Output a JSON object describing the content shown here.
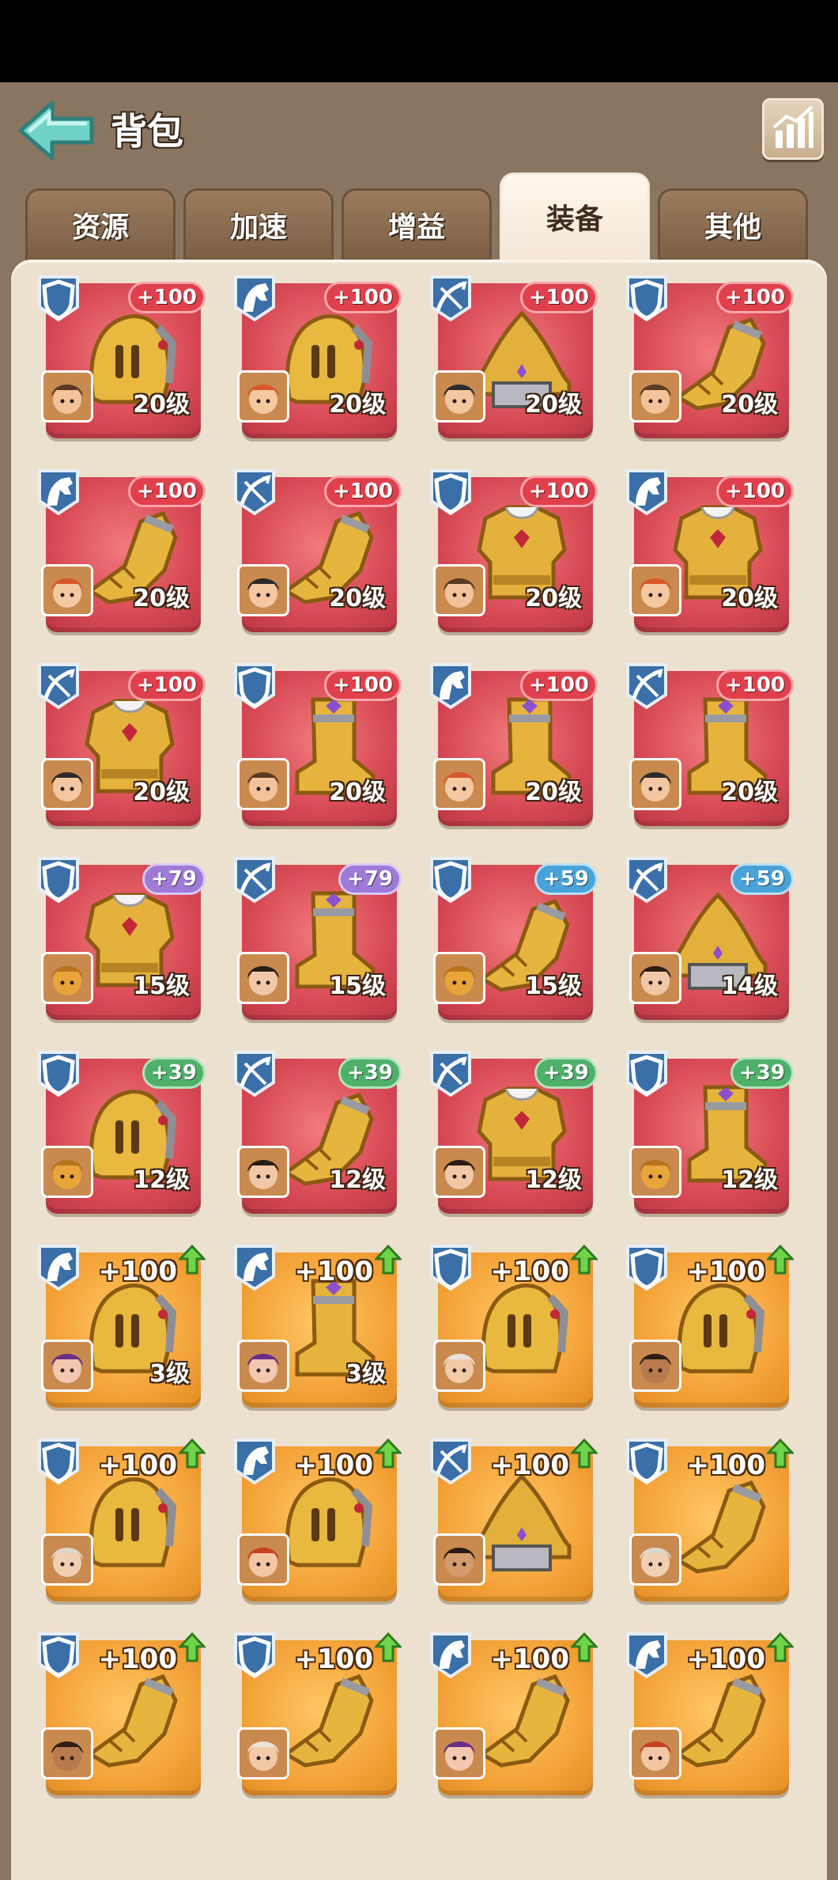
{
  "header": {
    "title": "背包"
  },
  "tabs": [
    {
      "label": "资源"
    },
    {
      "label": "加速"
    },
    {
      "label": "增益"
    },
    {
      "label": "装备",
      "active": true
    },
    {
      "label": "其他"
    }
  ],
  "colors": {
    "card_red": "#d84a55",
    "card_orange": "#f4a43a",
    "panel": "#ece1cf",
    "frame": "#8a7560"
  },
  "items": [
    {
      "bg": "red",
      "cls": "shield",
      "bonus": "+100",
      "bonus_style": "red",
      "level": "20级",
      "piece": "helmet",
      "hero": "hero-boy"
    },
    {
      "bg": "red",
      "cls": "horse",
      "bonus": "+100",
      "bonus_style": "red",
      "level": "20级",
      "piece": "helmet",
      "hero": "hero-redhair"
    },
    {
      "bg": "red",
      "cls": "bow",
      "bonus": "+100",
      "bonus_style": "red",
      "level": "20级",
      "piece": "hat",
      "hero": "hero-pirate"
    },
    {
      "bg": "red",
      "cls": "shield",
      "bonus": "+100",
      "bonus_style": "red",
      "level": "20级",
      "piece": "gauntlet",
      "hero": "hero-boy"
    },
    {
      "bg": "red",
      "cls": "horse",
      "bonus": "+100",
      "bonus_style": "red",
      "level": "20级",
      "piece": "gauntlet",
      "hero": "hero-redhair"
    },
    {
      "bg": "red",
      "cls": "bow",
      "bonus": "+100",
      "bonus_style": "red",
      "level": "20级",
      "piece": "gauntlet",
      "hero": "hero-pirate"
    },
    {
      "bg": "red",
      "cls": "shield",
      "bonus": "+100",
      "bonus_style": "red",
      "level": "20级",
      "piece": "armor",
      "hero": "hero-boy"
    },
    {
      "bg": "red",
      "cls": "horse",
      "bonus": "+100",
      "bonus_style": "red",
      "level": "20级",
      "piece": "armor",
      "hero": "hero-redhair"
    },
    {
      "bg": "red",
      "cls": "bow",
      "bonus": "+100",
      "bonus_style": "red",
      "level": "20级",
      "piece": "armor",
      "hero": "hero-pirate"
    },
    {
      "bg": "red",
      "cls": "shield",
      "bonus": "+100",
      "bonus_style": "red",
      "level": "20级",
      "piece": "boot",
      "hero": "hero-boy"
    },
    {
      "bg": "red",
      "cls": "horse",
      "bonus": "+100",
      "bonus_style": "red",
      "level": "20级",
      "piece": "boot",
      "hero": "hero-redhair"
    },
    {
      "bg": "red",
      "cls": "bow",
      "bonus": "+100",
      "bonus_style": "red",
      "level": "20级",
      "piece": "boot",
      "hero": "hero-pirate"
    },
    {
      "bg": "red",
      "cls": "shield",
      "bonus": "+79",
      "bonus_style": "purple",
      "level": "15级",
      "piece": "armor",
      "hero": "hero-spartan"
    },
    {
      "bg": "red",
      "cls": "bow",
      "bonus": "+79",
      "bonus_style": "purple",
      "level": "15级",
      "piece": "boot",
      "hero": "hero-darkhair"
    },
    {
      "bg": "red",
      "cls": "shield",
      "bonus": "+59",
      "bonus_style": "blue",
      "level": "15级",
      "piece": "gauntlet",
      "hero": "hero-spartan"
    },
    {
      "bg": "red",
      "cls": "bow",
      "bonus": "+59",
      "bonus_style": "blue",
      "level": "14级",
      "piece": "hat",
      "hero": "hero-darkhair"
    },
    {
      "bg": "red",
      "cls": "shield",
      "bonus": "+39",
      "bonus_style": "green",
      "level": "12级",
      "piece": "helmet",
      "hero": "hero-spartan"
    },
    {
      "bg": "red",
      "cls": "bow",
      "bonus": "+39",
      "bonus_style": "green",
      "level": "12级",
      "piece": "gauntlet",
      "hero": "hero-darkhair"
    },
    {
      "bg": "red",
      "cls": "bow",
      "bonus": "+39",
      "bonus_style": "green",
      "level": "12级",
      "piece": "armor",
      "hero": "hero-darkhair"
    },
    {
      "bg": "red",
      "cls": "shield",
      "bonus": "+39",
      "bonus_style": "green",
      "level": "12级",
      "piece": "boot",
      "hero": "hero-spartan"
    },
    {
      "bg": "orange",
      "cls": "horse",
      "bonus": "+100",
      "bonus_style": "plain",
      "level": "3级",
      "piece": "helmet",
      "hero": "hero-purplehair"
    },
    {
      "bg": "orange",
      "cls": "horse",
      "bonus": "+100",
      "bonus_style": "plain",
      "level": "3级",
      "piece": "boot",
      "hero": "hero-purplehair"
    },
    {
      "bg": "orange",
      "cls": "shield",
      "bonus": "+100",
      "bonus_style": "plain",
      "level": "",
      "piece": "helmet",
      "hero": "hero-oldman"
    },
    {
      "bg": "orange",
      "cls": "shield",
      "bonus": "+100",
      "bonus_style": "plain",
      "level": "",
      "piece": "helmet",
      "hero": "hero-darkgirl"
    },
    {
      "bg": "orange",
      "cls": "shield",
      "bonus": "+100",
      "bonus_style": "plain",
      "level": "",
      "piece": "helmet",
      "hero": "hero-whitehair"
    },
    {
      "bg": "orange",
      "cls": "horse",
      "bonus": "+100",
      "bonus_style": "plain",
      "level": "",
      "piece": "helmet",
      "hero": "hero-gingergirl"
    },
    {
      "bg": "orange",
      "cls": "bow",
      "bonus": "+100",
      "bonus_style": "plain",
      "level": "",
      "piece": "hat",
      "hero": "hero-boy2"
    },
    {
      "bg": "orange",
      "cls": "shield",
      "bonus": "+100",
      "bonus_style": "plain",
      "level": "",
      "piece": "gauntlet",
      "hero": "hero-whitehair"
    },
    {
      "bg": "orange",
      "cls": "shield",
      "bonus": "+100",
      "bonus_style": "plain",
      "level": "",
      "piece": "gauntlet",
      "hero": "hero-darkgirl"
    },
    {
      "bg": "orange",
      "cls": "shield",
      "bonus": "+100",
      "bonus_style": "plain",
      "level": "",
      "piece": "gauntlet",
      "hero": "hero-oldman"
    },
    {
      "bg": "orange",
      "cls": "horse",
      "bonus": "+100",
      "bonus_style": "plain",
      "level": "",
      "piece": "gauntlet",
      "hero": "hero-purplehair"
    },
    {
      "bg": "orange",
      "cls": "horse",
      "bonus": "+100",
      "bonus_style": "plain",
      "level": "",
      "piece": "gauntlet",
      "hero": "hero-gingergirl"
    }
  ]
}
